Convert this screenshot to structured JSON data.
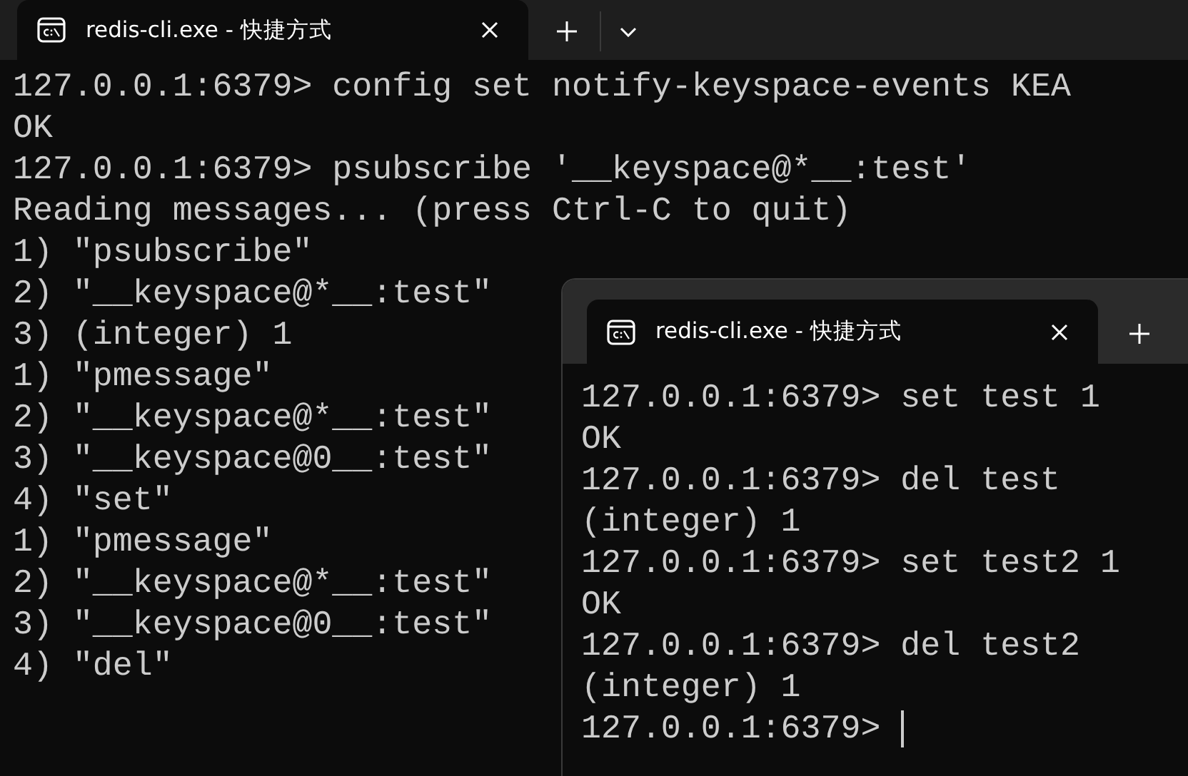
{
  "windows": [
    {
      "tab": {
        "title": "redis-cli.exe - 快捷方式"
      },
      "show_dropdown": true,
      "cursor": false,
      "lines": [
        "127.0.0.1:6379> config set notify-keyspace-events KEA",
        "OK",
        "127.0.0.1:6379> psubscribe '__keyspace@*__:test'",
        "Reading messages... (press Ctrl-C to quit)",
        "1) \"psubscribe\"",
        "2) \"__keyspace@*__:test\"",
        "3) (integer) 1",
        "1) \"pmessage\"",
        "2) \"__keyspace@*__:test\"",
        "3) \"__keyspace@0__:test\"",
        "4) \"set\"",
        "1) \"pmessage\"",
        "2) \"__keyspace@*__:test\"",
        "3) \"__keyspace@0__:test\"",
        "4) \"del\""
      ]
    },
    {
      "tab": {
        "title": "redis-cli.exe - 快捷方式"
      },
      "show_dropdown": false,
      "cursor": true,
      "lines": [
        "127.0.0.1:6379> set test 1",
        "OK",
        "127.0.0.1:6379> del test",
        "(integer) 1",
        "127.0.0.1:6379> set test2 1",
        "OK",
        "127.0.0.1:6379> del test2",
        "(integer) 1",
        "127.0.0.1:6379>"
      ]
    }
  ]
}
